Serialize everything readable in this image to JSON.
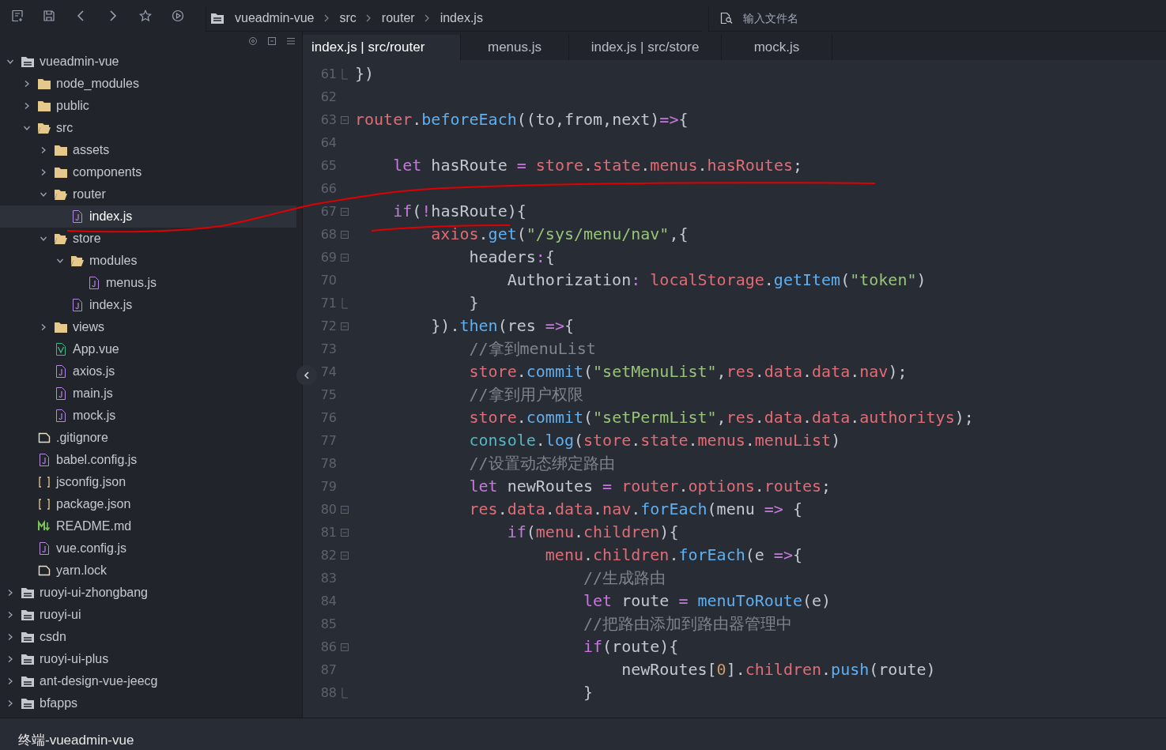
{
  "toolbar": {
    "breadcrumb": [
      "vueadmin-vue",
      "src",
      "router",
      "index.js"
    ],
    "search": {
      "placeholder": "输入文件名"
    }
  },
  "tabs": [
    {
      "label": "index.js | src/router",
      "selected": true
    },
    {
      "label": "menus.js",
      "selected": false
    },
    {
      "label": "index.js | src/store",
      "selected": false
    },
    {
      "label": "mock.js",
      "selected": false
    }
  ],
  "tree": [
    {
      "name": "vueadmin-vue",
      "kind": "project",
      "expanded": true,
      "selected": false,
      "children": [
        {
          "name": "node_modules",
          "kind": "folder",
          "expanded": false,
          "selected": false
        },
        {
          "name": "public",
          "kind": "folder",
          "expanded": false,
          "selected": false
        },
        {
          "name": "src",
          "kind": "folder",
          "expanded": true,
          "selected": false,
          "children": [
            {
              "name": "assets",
              "kind": "folder",
              "expanded": false,
              "selected": false
            },
            {
              "name": "components",
              "kind": "folder",
              "expanded": false,
              "selected": false
            },
            {
              "name": "router",
              "kind": "folder",
              "expanded": true,
              "selected": false,
              "children": [
                {
                  "name": "index.js",
                  "kind": "js",
                  "selected": true
                }
              ]
            },
            {
              "name": "store",
              "kind": "folder",
              "expanded": true,
              "selected": false,
              "children": [
                {
                  "name": "modules",
                  "kind": "folder",
                  "expanded": true,
                  "selected": false,
                  "children": [
                    {
                      "name": "menus.js",
                      "kind": "js",
                      "selected": false
                    }
                  ]
                },
                {
                  "name": "index.js",
                  "kind": "js",
                  "selected": false
                }
              ]
            },
            {
              "name": "views",
              "kind": "folder",
              "expanded": false,
              "selected": false
            },
            {
              "name": "App.vue",
              "kind": "vue",
              "selected": false
            },
            {
              "name": "axios.js",
              "kind": "js",
              "selected": false
            },
            {
              "name": "main.js",
              "kind": "js",
              "selected": false
            },
            {
              "name": "mock.js",
              "kind": "js",
              "selected": false
            }
          ]
        },
        {
          "name": ".gitignore",
          "kind": "file",
          "selected": false
        },
        {
          "name": "babel.config.js",
          "kind": "js",
          "selected": false
        },
        {
          "name": "jsconfig.json",
          "kind": "json",
          "selected": false
        },
        {
          "name": "package.json",
          "kind": "json",
          "selected": false
        },
        {
          "name": "README.md",
          "kind": "md",
          "selected": false
        },
        {
          "name": "vue.config.js",
          "kind": "js",
          "selected": false
        },
        {
          "name": "yarn.lock",
          "kind": "file",
          "selected": false
        }
      ]
    },
    {
      "name": "ruoyi-ui-zhongbang",
      "kind": "project",
      "expanded": false,
      "selected": false
    },
    {
      "name": "ruoyi-ui",
      "kind": "project",
      "expanded": false,
      "selected": false
    },
    {
      "name": "csdn",
      "kind": "project",
      "expanded": false,
      "selected": false
    },
    {
      "name": "ruoyi-ui-plus",
      "kind": "project",
      "expanded": false,
      "selected": false
    },
    {
      "name": "ant-design-vue-jeecg",
      "kind": "project",
      "expanded": false,
      "selected": false
    },
    {
      "name": "bfapps",
      "kind": "project",
      "expanded": false,
      "selected": false
    }
  ],
  "editor": {
    "lines": [
      {
        "number": "61",
        "foldable": false,
        "fold_end": true,
        "tokens": [
          {
            "kind": "plain",
            "text": "})"
          }
        ]
      },
      {
        "number": "62",
        "foldable": false,
        "fold_end": false
      },
      {
        "number": "63",
        "foldable": true,
        "fold_end": false,
        "tokens": [
          {
            "kind": "var",
            "text": "router"
          },
          {
            "kind": "plain",
            "text": "."
          },
          {
            "kind": "fn",
            "text": "beforeEach"
          },
          {
            "kind": "plain",
            "text": "((to,from,next)"
          },
          {
            "kind": "op",
            "text": "=>"
          },
          {
            "kind": "plain",
            "text": "{"
          }
        ]
      },
      {
        "number": "64",
        "foldable": false,
        "fold_end": false
      },
      {
        "number": "65",
        "foldable": false,
        "fold_end": false,
        "tokens": [
          {
            "kind": "kw",
            "text": "    let"
          },
          {
            "kind": "plain",
            "text": " hasRoute "
          },
          {
            "kind": "op",
            "text": "= "
          },
          {
            "kind": "var",
            "text": "store"
          },
          {
            "kind": "plain",
            "text": "."
          },
          {
            "kind": "var",
            "text": "state"
          },
          {
            "kind": "plain",
            "text": "."
          },
          {
            "kind": "var",
            "text": "menus"
          },
          {
            "kind": "plain",
            "text": "."
          },
          {
            "kind": "var",
            "text": "hasRoutes"
          },
          {
            "kind": "plain",
            "text": ";"
          }
        ]
      },
      {
        "number": "66",
        "foldable": false,
        "fold_end": false
      },
      {
        "number": "67",
        "foldable": true,
        "fold_end": false,
        "tokens": [
          {
            "kind": "kw",
            "text": "    if"
          },
          {
            "kind": "plain",
            "text": "("
          },
          {
            "kind": "op",
            "text": "!"
          },
          {
            "kind": "plain",
            "text": "hasRoute){"
          }
        ]
      },
      {
        "number": "68",
        "foldable": true,
        "fold_end": false,
        "tokens": [
          {
            "kind": "var",
            "text": "        axios"
          },
          {
            "kind": "plain",
            "text": "."
          },
          {
            "kind": "fn",
            "text": "get"
          },
          {
            "kind": "plain",
            "text": "("
          },
          {
            "kind": "str",
            "text": "\"/sys/menu/nav\""
          },
          {
            "kind": "plain",
            "text": ",{"
          }
        ]
      },
      {
        "number": "69",
        "foldable": true,
        "fold_end": false,
        "tokens": [
          {
            "kind": "plain",
            "text": "            headers"
          },
          {
            "kind": "op",
            "text": ":"
          },
          {
            "kind": "plain",
            "text": "{"
          }
        ]
      },
      {
        "number": "70",
        "foldable": false,
        "fold_end": false,
        "tokens": [
          {
            "kind": "plain",
            "text": "                Authorization"
          },
          {
            "kind": "op",
            "text": ": "
          },
          {
            "kind": "var",
            "text": "localStorage"
          },
          {
            "kind": "plain",
            "text": "."
          },
          {
            "kind": "fn",
            "text": "getItem"
          },
          {
            "kind": "plain",
            "text": "("
          },
          {
            "kind": "str",
            "text": "\"token\""
          },
          {
            "kind": "plain",
            "text": ")"
          }
        ]
      },
      {
        "number": "71",
        "foldable": false,
        "fold_end": true,
        "tokens": [
          {
            "kind": "plain",
            "text": "            }"
          }
        ]
      },
      {
        "number": "72",
        "foldable": true,
        "fold_end": false,
        "tokens": [
          {
            "kind": "plain",
            "text": "        })."
          },
          {
            "kind": "fn",
            "text": "then"
          },
          {
            "kind": "plain",
            "text": "(res "
          },
          {
            "kind": "op",
            "text": "=>"
          },
          {
            "kind": "plain",
            "text": "{"
          }
        ]
      },
      {
        "number": "73",
        "foldable": false,
        "fold_end": false,
        "tokens": [
          {
            "kind": "comment",
            "text": "            //拿到menuList"
          }
        ]
      },
      {
        "number": "74",
        "foldable": false,
        "fold_end": false,
        "tokens": [
          {
            "kind": "var",
            "text": "            store"
          },
          {
            "kind": "plain",
            "text": "."
          },
          {
            "kind": "fn",
            "text": "commit"
          },
          {
            "kind": "plain",
            "text": "("
          },
          {
            "kind": "str",
            "text": "\"setMenuList\""
          },
          {
            "kind": "plain",
            "text": ","
          },
          {
            "kind": "var",
            "text": "res"
          },
          {
            "kind": "plain",
            "text": "."
          },
          {
            "kind": "var",
            "text": "data"
          },
          {
            "kind": "plain",
            "text": "."
          },
          {
            "kind": "var",
            "text": "data"
          },
          {
            "kind": "plain",
            "text": "."
          },
          {
            "kind": "var",
            "text": "nav"
          },
          {
            "kind": "plain",
            "text": ");"
          }
        ]
      },
      {
        "number": "75",
        "foldable": false,
        "fold_end": false,
        "tokens": [
          {
            "kind": "comment",
            "text": "            //拿到用户权限"
          }
        ]
      },
      {
        "number": "76",
        "foldable": false,
        "fold_end": false,
        "tokens": [
          {
            "kind": "var",
            "text": "            store"
          },
          {
            "kind": "plain",
            "text": "."
          },
          {
            "kind": "fn",
            "text": "commit"
          },
          {
            "kind": "plain",
            "text": "("
          },
          {
            "kind": "str",
            "text": "\"setPermList\""
          },
          {
            "kind": "plain",
            "text": ","
          },
          {
            "kind": "var",
            "text": "res"
          },
          {
            "kind": "plain",
            "text": "."
          },
          {
            "kind": "var",
            "text": "data"
          },
          {
            "kind": "plain",
            "text": "."
          },
          {
            "kind": "var",
            "text": "data"
          },
          {
            "kind": "plain",
            "text": "."
          },
          {
            "kind": "var",
            "text": "authoritys"
          },
          {
            "kind": "plain",
            "text": ");"
          }
        ]
      },
      {
        "number": "77",
        "foldable": false,
        "fold_end": false,
        "tokens": [
          {
            "kind": "builtin",
            "text": "            console"
          },
          {
            "kind": "plain",
            "text": "."
          },
          {
            "kind": "fn",
            "text": "log"
          },
          {
            "kind": "plain",
            "text": "("
          },
          {
            "kind": "var",
            "text": "store"
          },
          {
            "kind": "plain",
            "text": "."
          },
          {
            "kind": "var",
            "text": "state"
          },
          {
            "kind": "plain",
            "text": "."
          },
          {
            "kind": "var",
            "text": "menus"
          },
          {
            "kind": "plain",
            "text": "."
          },
          {
            "kind": "var",
            "text": "menuList"
          },
          {
            "kind": "plain",
            "text": ")"
          }
        ]
      },
      {
        "number": "78",
        "foldable": false,
        "fold_end": false,
        "tokens": [
          {
            "kind": "comment",
            "text": "            //设置动态绑定路由"
          }
        ]
      },
      {
        "number": "79",
        "foldable": false,
        "fold_end": false,
        "tokens": [
          {
            "kind": "kw",
            "text": "            let"
          },
          {
            "kind": "plain",
            "text": " newRoutes "
          },
          {
            "kind": "op",
            "text": "= "
          },
          {
            "kind": "var",
            "text": "router"
          },
          {
            "kind": "plain",
            "text": "."
          },
          {
            "kind": "var",
            "text": "options"
          },
          {
            "kind": "plain",
            "text": "."
          },
          {
            "kind": "var",
            "text": "routes"
          },
          {
            "kind": "plain",
            "text": ";"
          }
        ]
      },
      {
        "number": "80",
        "foldable": true,
        "fold_end": false,
        "tokens": [
          {
            "kind": "var",
            "text": "            res"
          },
          {
            "kind": "plain",
            "text": "."
          },
          {
            "kind": "var",
            "text": "data"
          },
          {
            "kind": "plain",
            "text": "."
          },
          {
            "kind": "var",
            "text": "data"
          },
          {
            "kind": "plain",
            "text": "."
          },
          {
            "kind": "var",
            "text": "nav"
          },
          {
            "kind": "plain",
            "text": "."
          },
          {
            "kind": "fn",
            "text": "forEach"
          },
          {
            "kind": "plain",
            "text": "(menu "
          },
          {
            "kind": "op",
            "text": "=>"
          },
          {
            "kind": "plain",
            "text": " {"
          }
        ]
      },
      {
        "number": "81",
        "foldable": true,
        "fold_end": false,
        "tokens": [
          {
            "kind": "kw",
            "text": "                if"
          },
          {
            "kind": "plain",
            "text": "("
          },
          {
            "kind": "var",
            "text": "menu"
          },
          {
            "kind": "plain",
            "text": "."
          },
          {
            "kind": "var",
            "text": "children"
          },
          {
            "kind": "plain",
            "text": "){"
          }
        ]
      },
      {
        "number": "82",
        "foldable": true,
        "fold_end": false,
        "tokens": [
          {
            "kind": "var",
            "text": "                    menu"
          },
          {
            "kind": "plain",
            "text": "."
          },
          {
            "kind": "var",
            "text": "children"
          },
          {
            "kind": "plain",
            "text": "."
          },
          {
            "kind": "fn",
            "text": "forEach"
          },
          {
            "kind": "plain",
            "text": "(e "
          },
          {
            "kind": "op",
            "text": "=>"
          },
          {
            "kind": "plain",
            "text": "{"
          }
        ]
      },
      {
        "number": "83",
        "foldable": false,
        "fold_end": false,
        "tokens": [
          {
            "kind": "comment",
            "text": "                        //生成路由"
          }
        ]
      },
      {
        "number": "84",
        "foldable": false,
        "fold_end": false,
        "tokens": [
          {
            "kind": "kw",
            "text": "                        let"
          },
          {
            "kind": "plain",
            "text": " route "
          },
          {
            "kind": "op",
            "text": "= "
          },
          {
            "kind": "fn",
            "text": "menuToRoute"
          },
          {
            "kind": "plain",
            "text": "(e)"
          }
        ]
      },
      {
        "number": "85",
        "foldable": false,
        "fold_end": false,
        "tokens": [
          {
            "kind": "comment",
            "text": "                        //把路由添加到路由器管理中"
          }
        ]
      },
      {
        "number": "86",
        "foldable": true,
        "fold_end": false,
        "tokens": [
          {
            "kind": "kw",
            "text": "                        if"
          },
          {
            "kind": "plain",
            "text": "(route){"
          }
        ]
      },
      {
        "number": "87",
        "foldable": false,
        "fold_end": false,
        "tokens": [
          {
            "kind": "plain",
            "text": "                            newRoutes["
          },
          {
            "kind": "num",
            "text": "0"
          },
          {
            "kind": "plain",
            "text": "]."
          },
          {
            "kind": "var",
            "text": "children"
          },
          {
            "kind": "plain",
            "text": "."
          },
          {
            "kind": "fn",
            "text": "push"
          },
          {
            "kind": "plain",
            "text": "(route)"
          }
        ]
      },
      {
        "number": "88",
        "foldable": false,
        "fold_end": true,
        "tokens": [
          {
            "kind": "plain",
            "text": "                        }"
          }
        ]
      }
    ]
  },
  "bottom_panel": {
    "title": "终端-vueadmin-vue"
  }
}
